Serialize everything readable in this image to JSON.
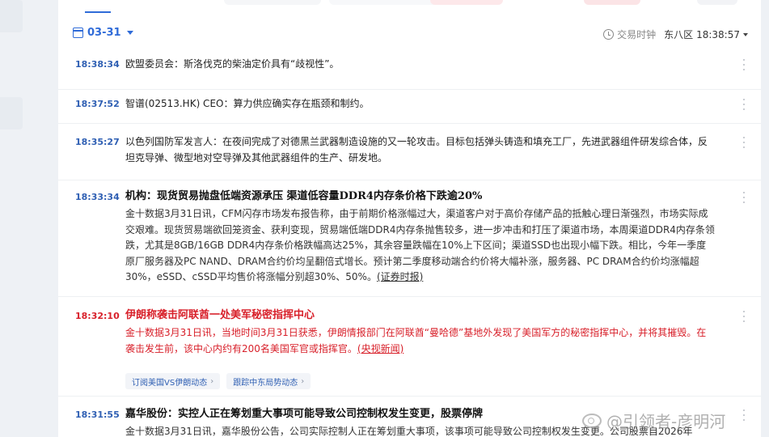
{
  "toolbar": {
    "date": "03-31",
    "trade_clock_label": "交易时钟",
    "timezone": "东八区",
    "time": "18:38:57"
  },
  "feed": [
    {
      "time": "18:38:34",
      "text": "欧盟委员会：斯洛伐克的柴油定价具有“歧视性”。"
    },
    {
      "time": "18:37:52",
      "text": "智谱(02513.HK) CEO：算力供应确实存在瓶颈和制约。"
    },
    {
      "time": "18:35:27",
      "text": "以色列国防军发言人：在夜间完成了对德黑兰武器制造设施的又一轮攻击。目标包括弹头铸造和填充工厂，先进武器组件研发综合体，反坦克导弹、微型地对空导弹及其他武器组件的生产、研发地。"
    },
    {
      "time": "18:33:34",
      "title": "机构：现货贸易抛盘低端资源承压 渠道低容量DDR4内存条价格下跌逾20%",
      "body": "金十数据3月31日讯，CFM闪存市场发布报告称，由于前期价格涨幅过大，渠道客户对于高价存储产品的抵触心理日渐强烈，市场实际成交艰难。现货贸易端欲回笼资金、获利变现，贸易端低端DDR4内存条抛售较多，进一步冲击和打压了渠道市场，本周渠道DDR4内存条领跌，尤其是8GB/16GB DDR4内存条价格跌幅高达25%，其余容量跌幅在10%上下区间；渠道SSD也出现小幅下跌。相比，今年一季度原厂服务器及PC NAND、DRAM合约价均呈翻倍式增长。预计第二季度移动端合约价将大幅补涨，服务器、PC DRAM合约价均涨幅超30%，eSSD、cSSD平均售价将涨幅分别超30%、50%。",
      "source": "(证券时报)"
    },
    {
      "time": "18:32:10",
      "title": "伊朗称袭击阿联酋一处美军秘密指挥中心",
      "body": "金十数据3月31日讯，当地时间3月31日获悉，伊朗情报部门在阿联酋“曼哈德”基地外发现了美国军方的秘密指挥中心，并将其摧毁。在袭击发生前，该中心内约有200名美国军官或指挥官。",
      "source": "(央视新闻)",
      "tags": [
        "订阅美国VS伊朗动态",
        "跟踪中东局势动态"
      ]
    },
    {
      "time": "18:31:55",
      "title": "嘉华股份：实控人正在筹划重大事项可能导致公司控制权发生变更，股票停牌",
      "body": "金十数据3月31日讯，嘉华股份公告，公司实际控制人正在筹划重大事项，该事项可能导致公司控制权发生变更。公司股票自2026年"
    }
  ],
  "watermark": "@引领者-彦明河"
}
